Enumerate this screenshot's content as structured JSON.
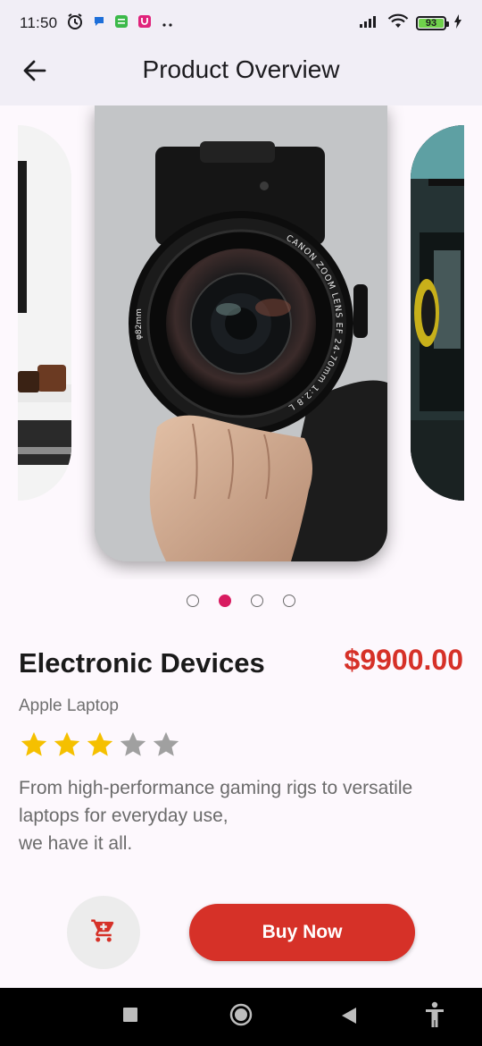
{
  "status_bar": {
    "time": "11:50",
    "battery": "93",
    "battery_level": 0.93,
    "icons": [
      "alarm-icon",
      "chat-bubble-icon",
      "message-app-icon",
      "notification-app-icon",
      "more-dots-icon",
      "signal-icon",
      "wifi-icon",
      "battery-icon",
      "charging-icon"
    ]
  },
  "app_bar": {
    "title": "Product Overview",
    "back_icon": "arrow-back-icon"
  },
  "carousel": {
    "slides": [
      "desk-laptop-image",
      "camera-lens-image",
      "monitor-setup-image"
    ],
    "active_index": 1,
    "dot_count": 4,
    "lens_text": "CANON ZOOM LENS EF 24-70mm 1:2.8 L II USM",
    "lens_side_text": "φ82mm"
  },
  "product": {
    "name": "Electronic Devices",
    "price": "$9900.00",
    "subtitle": "Apple Laptop",
    "rating": 3,
    "rating_max": 5,
    "description": "From high-performance gaming rigs to versatile laptops for everyday use,\nwe have it all."
  },
  "actions": {
    "cart_icon": "cart-icon",
    "buy_label": "Buy Now"
  },
  "colors": {
    "accent": "#d63128",
    "star": "#f5c000",
    "star_empty": "#a0a0a0",
    "dot_active": "#d81b60",
    "app_bar_bg": "#f1eef6"
  },
  "nav_bar": {
    "icons": [
      "recent-apps-icon",
      "home-icon",
      "back-triangle-icon",
      "accessibility-icon"
    ]
  }
}
